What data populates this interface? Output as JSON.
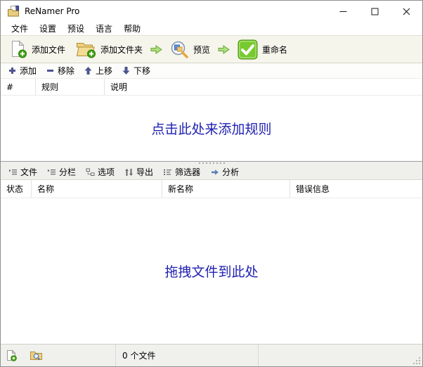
{
  "window": {
    "title": "ReNamer Pro"
  },
  "menubar": {
    "items": [
      "文件",
      "设置",
      "预设",
      "语言",
      "帮助"
    ]
  },
  "main_toolbar": {
    "add_files": "添加文件",
    "add_folders": "添加文件夹",
    "preview": "预览",
    "rename": "重命名"
  },
  "rules_toolbar": {
    "add": "添加",
    "remove": "移除",
    "move_up": "上移",
    "move_down": "下移"
  },
  "rules_table": {
    "columns": [
      "#",
      "规则",
      "说明"
    ],
    "rows": [],
    "empty_hint": "点击此处来添加规则"
  },
  "files_toolbar": {
    "items": [
      "文件",
      "分栏",
      "选项",
      "导出",
      "筛选器",
      "分析"
    ]
  },
  "files_table": {
    "columns": [
      "状态",
      "名称",
      "新名称",
      "错误信息"
    ],
    "rows": [],
    "empty_hint": "拖拽文件到此处"
  },
  "statusbar": {
    "file_count": "0 个文件"
  },
  "icons": {
    "app": "renamer-folder-icon",
    "add_files": "page-plus-icon",
    "add_folders": "folder-plus-icon",
    "flow_arrow": "green-right-arrow-icon",
    "preview": "magnifier-icon",
    "rename": "green-check-icon",
    "rule_add": "plus-icon",
    "rule_remove": "minus-icon",
    "rule_up": "arrow-up-icon",
    "rule_down": "arrow-down-icon",
    "files_menu": "list-menu-icon",
    "columns_menu": "list-menu-icon",
    "options_menu": "nodes-icon",
    "export_menu": "sort-arrows-icon",
    "filters_menu": "filter-list-icon",
    "analyze_menu": "flow-arrow-icon",
    "status_add_file": "page-plus-icon",
    "status_browse_folder": "folder-search-icon",
    "minimize": "minimize-icon",
    "maximize": "maximize-icon",
    "close": "close-icon"
  },
  "colors": {
    "accent_green": "#5cb427",
    "hint_text": "#2121b2",
    "toolbar_bg": "#f6f5ec",
    "panel_bg": "#efefec",
    "slate_icon": "#4d548f",
    "statusbar_bg": "#f0f0ed"
  }
}
